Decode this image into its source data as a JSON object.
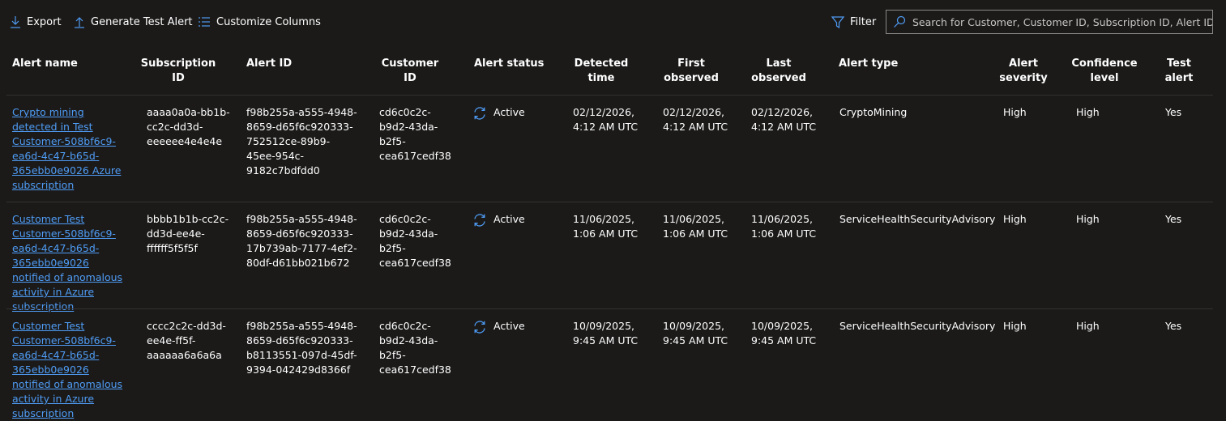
{
  "toolbar": {
    "export_label": "Export",
    "generate_label": "Generate Test Alert",
    "customize_label": "Customize Columns",
    "filter_label": "Filter",
    "search_placeholder": "Search for Customer, Customer ID, Subscription ID, Alert ID..."
  },
  "colors": {
    "background": "#1b1a19",
    "link": "#4f9cf5",
    "icon": "#4f9cf5",
    "border": "#8a8886"
  },
  "icons": {
    "export": "download-arrow-icon",
    "generate": "upload-arrow-icon",
    "customize": "columns-list-icon",
    "filter": "funnel-icon",
    "search": "search-icon",
    "status": "sync-icon"
  },
  "table": {
    "headers": {
      "alert_name": "Alert name",
      "subscription_id": "Subscription ID",
      "alert_id": "Alert ID",
      "customer_id": "Customer ID",
      "alert_status": "Alert status",
      "detected_time": "Detected time",
      "first_observed": "First observed",
      "last_observed": "Last observed",
      "alert_type": "Alert type",
      "alert_severity": "Alert severity",
      "confidence_level": "Confidence level",
      "test_alert": "Test alert"
    },
    "rows": [
      {
        "alert_name": "Crypto mining detected in Test Customer-508bf6c9-ea6d-4c47-b65d-365ebb0e9026 Azure subscription",
        "subscription_id": "aaaa0a0a-bb1b-cc2c-dd3d-eeeeee4e4e4e",
        "alert_id": "f98b255a-a555-4948-8659-d65f6c920333-752512ce-89b9-45ee-954c-9182c7bdfdd0",
        "customer_id": "cd6c0c2c-b9d2-43da-b2f5-cea617cedf38",
        "alert_status": "Active",
        "detected_time": "02/12/2026, 4:12 AM UTC",
        "first_observed": "02/12/2026, 4:12 AM UTC",
        "last_observed": "02/12/2026, 4:12 AM UTC",
        "alert_type": "CryptoMining",
        "alert_severity": "High",
        "confidence_level": "High",
        "test_alert": "Yes"
      },
      {
        "alert_name": "Customer Test Customer-508bf6c9-ea6d-4c47-b65d-365ebb0e9026 notified of anomalous activity in Azure subscription",
        "subscription_id": "bbbb1b1b-cc2c-dd3d-ee4e-ffffff5f5f5f",
        "alert_id": "f98b255a-a555-4948-8659-d65f6c920333-17b739ab-7177-4ef2-80df-d61bb021b672",
        "customer_id": "cd6c0c2c-b9d2-43da-b2f5-cea617cedf38",
        "alert_status": "Active",
        "detected_time": "11/06/2025, 1:06 AM UTC",
        "first_observed": "11/06/2025, 1:06 AM UTC",
        "last_observed": "11/06/2025, 1:06 AM UTC",
        "alert_type": "ServiceHealthSecurityAdvisory",
        "alert_severity": "High",
        "confidence_level": "High",
        "test_alert": "Yes"
      },
      {
        "alert_name": "Customer Test Customer-508bf6c9-ea6d-4c47-b65d-365ebb0e9026 notified of anomalous activity in Azure subscription",
        "subscription_id": "cccc2c2c-dd3d-ee4e-ff5f-aaaaaa6a6a6a",
        "alert_id": "f98b255a-a555-4948-8659-d65f6c920333-b8113551-097d-45df-9394-042429d8366f",
        "customer_id": "cd6c0c2c-b9d2-43da-b2f5-cea617cedf38",
        "alert_status": "Active",
        "detected_time": "10/09/2025, 9:45 AM UTC",
        "first_observed": "10/09/2025, 9:45 AM UTC",
        "last_observed": "10/09/2025, 9:45 AM UTC",
        "alert_type": "ServiceHealthSecurityAdvisory",
        "alert_severity": "High",
        "confidence_level": "High",
        "test_alert": "Yes"
      }
    ]
  }
}
